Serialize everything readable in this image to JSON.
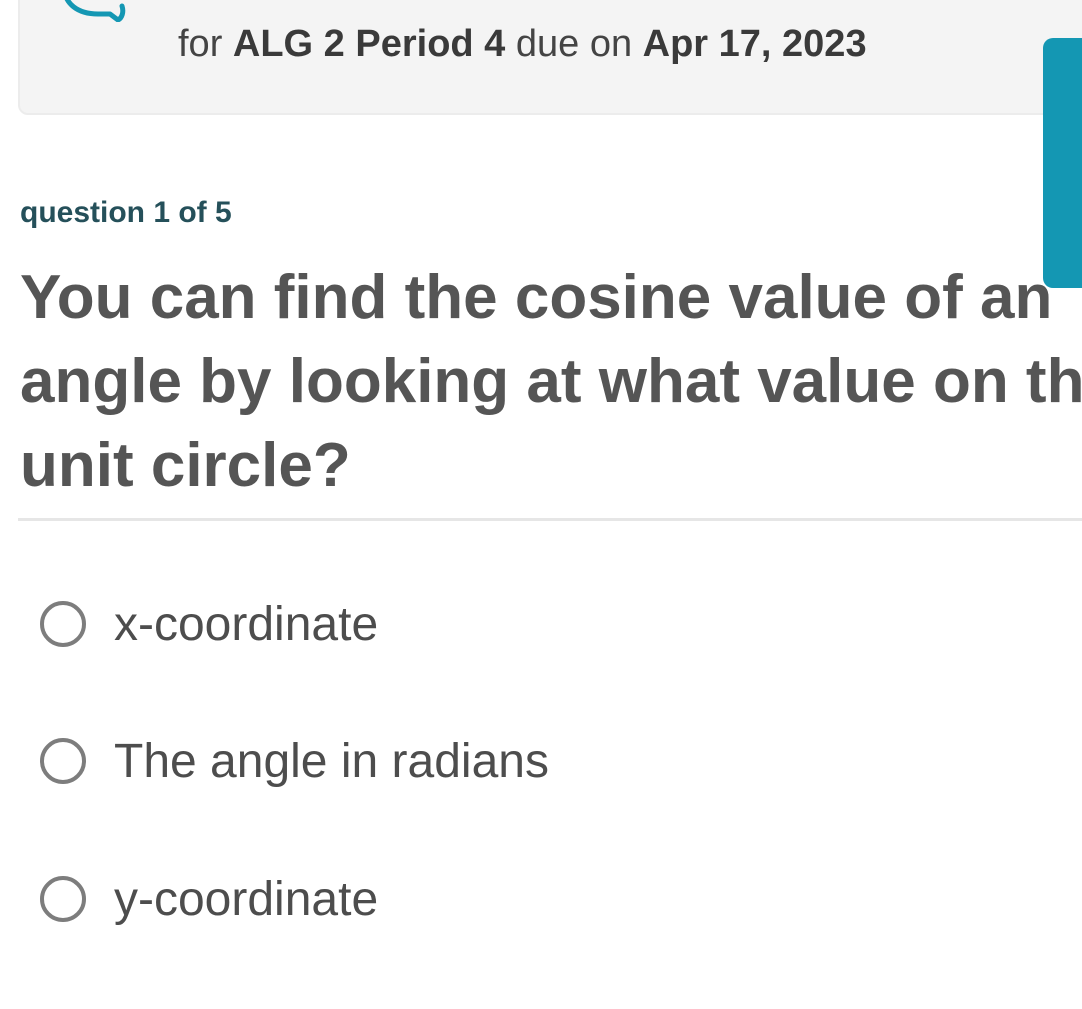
{
  "banner": {
    "prefix": "for ",
    "class_name": "ALG 2 Period 4",
    "due_text": " due on ",
    "due_date": "Apr 17, 2023",
    "icon": "chat-bubble-icon"
  },
  "question": {
    "counter": "question 1 of 5",
    "prompt_lines": [
      "You can find the cosine value of an",
      "angle by looking at what value on the",
      "unit circle?"
    ]
  },
  "choices": [
    {
      "label": "x-coordinate",
      "selected": false
    },
    {
      "label": "The angle in radians",
      "selected": false
    },
    {
      "label": "y-coordinate",
      "selected": false
    }
  ],
  "colors": {
    "accent": "#1497b3",
    "counter_text": "#25505a",
    "prompt_text": "#555555",
    "radio_border": "#7d7d7d"
  }
}
